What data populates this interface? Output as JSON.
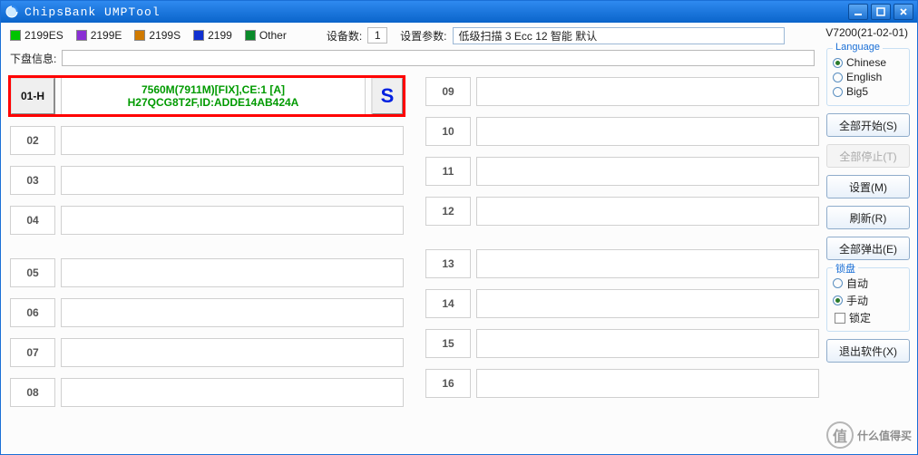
{
  "window": {
    "title": "ChipsBank UMPTool"
  },
  "legend": [
    {
      "label": "2199ES",
      "color": "#00c400"
    },
    {
      "label": "2199E",
      "color": "#8a2fd4"
    },
    {
      "label": "2199S",
      "color": "#d07a00"
    },
    {
      "label": "2199",
      "color": "#1030d0"
    },
    {
      "label": "Other",
      "color": "#0a8a2a"
    }
  ],
  "top": {
    "devcount_label": "设备数:",
    "devcount_value": "1",
    "param_label": "设置参数:",
    "param_value": "低级扫描 3 Ecc 12 智能 默认",
    "version": "V7200(21-02-01)"
  },
  "diskinfo": {
    "label": "下盘信息:",
    "value": ""
  },
  "slots_left": [
    {
      "num": "01-H",
      "line1": "7560M(7911M)[FIX],CE:1 [A]",
      "line2": "H27QCG8T2F,ID:ADDE14AB424A",
      "status": "S",
      "highlight": true
    },
    {
      "num": "02"
    },
    {
      "num": "03"
    },
    {
      "num": "04"
    },
    {
      "num": "05"
    },
    {
      "num": "06"
    },
    {
      "num": "07"
    },
    {
      "num": "08"
    }
  ],
  "slots_right": [
    {
      "num": "09"
    },
    {
      "num": "10"
    },
    {
      "num": "11"
    },
    {
      "num": "12"
    },
    {
      "num": "13"
    },
    {
      "num": "14"
    },
    {
      "num": "15"
    },
    {
      "num": "16"
    }
  ],
  "lang": {
    "title": "Language",
    "options": [
      {
        "label": "Chinese",
        "selected": true
      },
      {
        "label": "English",
        "selected": false
      },
      {
        "label": "Big5",
        "selected": false
      }
    ]
  },
  "buttons": {
    "start": "全部开始(S)",
    "stop": "全部停止(T)",
    "settings": "设置(M)",
    "refresh": "刷新(R)",
    "eject": "全部弹出(E)",
    "exit": "退出软件(X)"
  },
  "lock": {
    "title": "锁盘",
    "auto": "自动",
    "manual": "手动",
    "locked": "锁定",
    "selected": "manual"
  },
  "watermark": "什么值得买"
}
